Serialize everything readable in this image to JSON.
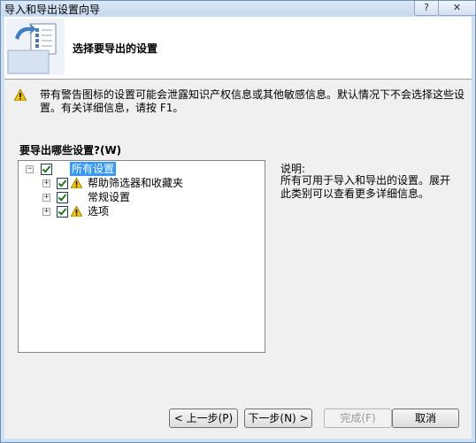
{
  "window": {
    "title": "导入和导出设置向导",
    "help_label": "?",
    "close_label": "✕"
  },
  "header": {
    "title": "选择要导出的设置"
  },
  "warning": {
    "text": "带有警告图标的设置可能会泄露知识产权信息或其他敏感信息。默认情况下不会选择这些设置。有关详细信息，请按 F1。"
  },
  "tree": {
    "label": "要导出哪些设置?(W)",
    "root": {
      "label": "所有设置",
      "expander": "−",
      "checked": true
    },
    "items": [
      {
        "label": "帮助筛选器和收藏夹",
        "expander": "+",
        "checked": true,
        "warning": true
      },
      {
        "label": "常规设置",
        "expander": "+",
        "checked": true,
        "warning": false
      },
      {
        "label": "选项",
        "expander": "+",
        "checked": true,
        "warning": true
      }
    ]
  },
  "description": {
    "title": "说明:",
    "text": "所有可用于导入和导出的设置。展开此类别可以查看更多详细信息。"
  },
  "buttons": {
    "back": "< 上一步(P)",
    "next": "下一步(N) >",
    "finish": "完成(F)",
    "cancel": "取消"
  },
  "colors": {
    "selection": "#3399ff",
    "title_bar": "#cfe0f3",
    "warning_icon": "#f5c400"
  }
}
